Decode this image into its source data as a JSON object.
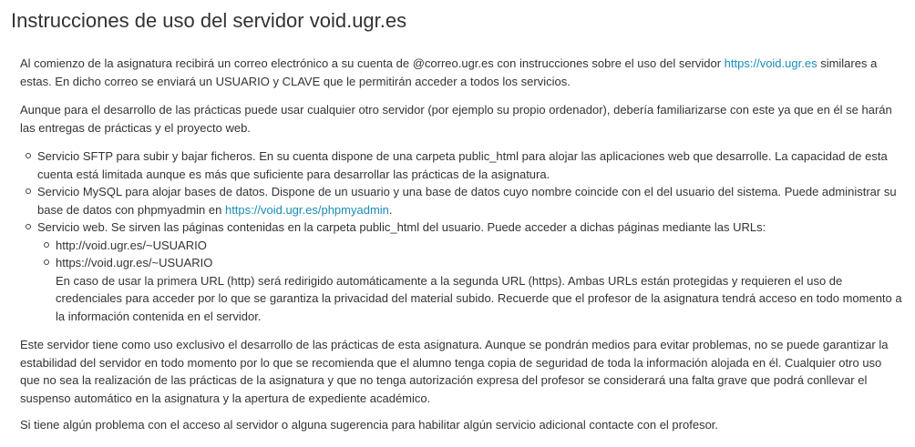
{
  "page": {
    "title": "Instrucciones de uso del servidor void.ugr.es"
  },
  "intro": {
    "text_before_link": "Al comienzo de la asignatura recibirá un correo electrónico a su cuenta de @correo.ugr.es con instrucciones sobre el uso del servidor ",
    "link_text": "https://void.ugr.es",
    "text_after_link": " similares a estas. En dicho correo se enviará un USUARIO y CLAVE que le permitirán acceder a todos los servicios."
  },
  "paragraph2": "Aunque para el desarrollo de las prácticas puede usar cualquier otro servidor (por ejemplo su propio ordenador), debería familiarizarse con este ya que en él se harán las entregas de prácticas y el proyecto web.",
  "services": {
    "sftp": "Servicio SFTP para subir y bajar ficheros. En su cuenta dispone de una carpeta public_html para alojar las aplicaciones web que desarrolle. La capacidad de esta cuenta está limitada aunque es más que suficiente para desarrollar las prácticas de la asignatura.",
    "mysql_before_link": "Servicio MySQL para alojar bases de datos. Dispone de un usuario y una base de datos cuyo nombre coincide con el del usuario del sistema. Puede administrar su base de datos con phpmyadmin en ",
    "mysql_link": "https://void.ugr.es/phpmyadmin",
    "mysql_after_link": ".",
    "web": "Servicio web. Se sirven las páginas contenidas en la carpeta public_html del usuario. Puede acceder a dichas páginas mediante las URLs:",
    "urls": [
      "http://void.ugr.es/~USUARIO",
      "https://void.ugr.es/~USUARIO"
    ],
    "url_note": "En caso de usar la primera URL (http) será redirigido automáticamente a la segunda URL (https). Ambas URLs están protegidas y requieren el uso de credenciales para acceder por lo que se garantiza la privacidad del material subido. Recuerde que el profesor de la asignatura tendrá acceso en todo momento a la información contenida en el servidor."
  },
  "paragraph3": "Este servidor tiene como uso exclusivo el desarrollo de las prácticas de esta asignatura. Aunque se pondrán medios para evitar problemas, no se puede garantizar la estabilidad del servidor en todo momento por lo que se recomienda que el alumno tenga copia de seguridad de toda la información alojada en él. Cualquier otro uso que no sea la realización de las prácticas de la asignatura y que no tenga autorización expresa del profesor se considerará una falta grave que podrá conllevar el suspenso automático en la asignatura y la apertura de expediente académico.",
  "paragraph4": "Si tiene algún problema con el acceso al servidor o alguna sugerencia para habilitar algún servicio adicional contacte con el profesor.",
  "colors": {
    "text": "#333333",
    "link": "#1a8cb8",
    "background": "#ffffff"
  }
}
